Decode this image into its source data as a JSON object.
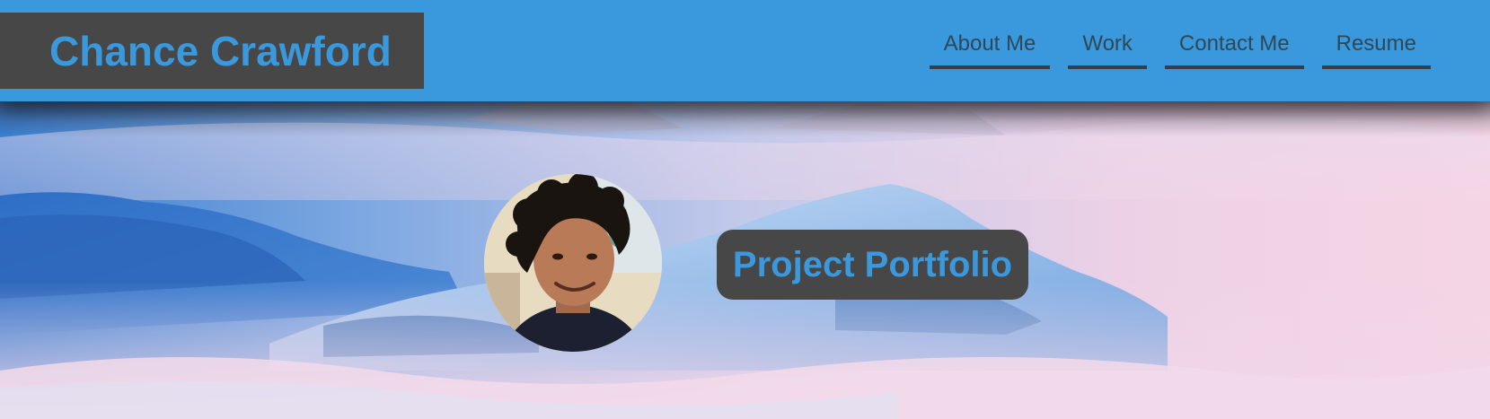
{
  "header": {
    "brand_name": "Chance Crawford",
    "nav": [
      "About Me",
      "Work",
      "Contact Me",
      "Resume"
    ]
  },
  "hero": {
    "title": "Project Portfolio",
    "avatar": "profile-photo",
    "background": "snowy-mountains-above-clouds"
  },
  "colors": {
    "header_bg": "#3a98dc",
    "brand_box_bg": "#474747",
    "brand_text": "#3a98dc",
    "nav_text": "#2f4858",
    "nav_underline": "#3a3d44",
    "badge_bg": "#474747",
    "badge_text": "#3a98dc"
  }
}
